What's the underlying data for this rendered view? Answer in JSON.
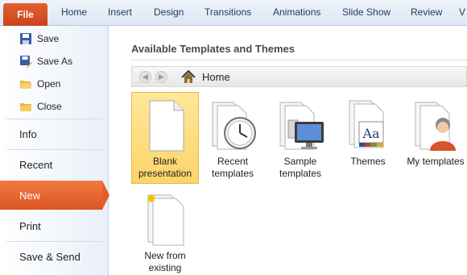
{
  "ribbon": {
    "file": "File",
    "tabs": [
      "Home",
      "Insert",
      "Design",
      "Transitions",
      "Animations",
      "Slide Show",
      "Review",
      "V"
    ]
  },
  "backstage": {
    "commands": [
      {
        "label": "Save",
        "icon": "save-icon"
      },
      {
        "label": "Save As",
        "icon": "save-as-icon"
      },
      {
        "label": "Open",
        "icon": "open-folder-icon"
      },
      {
        "label": "Close",
        "icon": "close-folder-icon"
      }
    ],
    "sections": [
      "Info",
      "Recent",
      "New",
      "Print",
      "Save & Send"
    ],
    "active_section": "New"
  },
  "main": {
    "heading": "Available Templates and Themes",
    "location": "Home",
    "templates": [
      {
        "label": "Blank\npresentation",
        "icon": "blank-page-icon",
        "selected": true
      },
      {
        "label": "Recent\ntemplates",
        "icon": "clock-icon",
        "selected": false
      },
      {
        "label": "Sample\ntemplates",
        "icon": "monitor-icon",
        "selected": false
      },
      {
        "label": "Themes",
        "icon": "themes-icon",
        "selected": false
      },
      {
        "label": "My templates",
        "icon": "user-icon",
        "selected": false
      },
      {
        "label": "New from\nexisting",
        "icon": "new-from-existing-icon",
        "selected": false
      }
    ]
  },
  "colors": {
    "file_tab": "#d24d22",
    "active_section": "#e25f2b",
    "selected_tile": "#fcd46a"
  }
}
